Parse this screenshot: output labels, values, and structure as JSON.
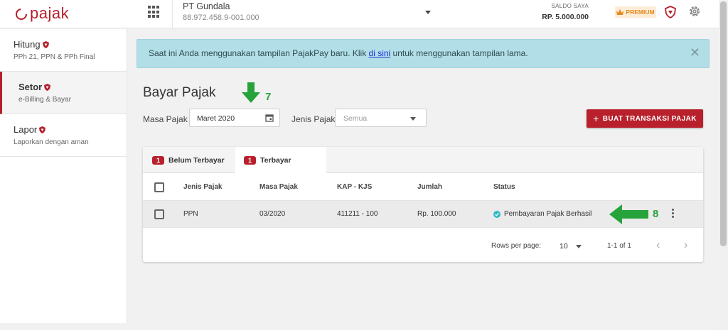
{
  "header": {
    "logo": "pajak",
    "company_name": "PT Gundala",
    "company_npwp": "88.972.458.9-001.000",
    "saldo_label": "SALDO SAYA",
    "saldo_value": "RP. 5.000.000",
    "premium_label": "PREMIUM",
    "brand_color": "#b5202b"
  },
  "sidebar": {
    "items": [
      {
        "title": "Hitung",
        "subtitle": "PPh 21, PPN & PPh Final",
        "active": false
      },
      {
        "title": "Setor",
        "subtitle": "e-Billing & Bayar",
        "active": true
      },
      {
        "title": "Lapor",
        "subtitle": "Laporkan dengan aman",
        "active": false
      }
    ]
  },
  "alert": {
    "text_before": "Saat ini Anda menggunakan tampilan PajakPay baru. Klik ",
    "link": "di sini",
    "text_after": " untuk menggunakan tampilan lama.",
    "close": "✕"
  },
  "page": {
    "title": "Bayar Pajak",
    "annotation_7": "7",
    "annotation_8": "8",
    "annotation_color": "#27a33c"
  },
  "filters": {
    "masa_label": "Masa Pajak",
    "masa_value": "Maret 2020",
    "jenis_label": "Jenis Pajak",
    "jenis_placeholder": "Semua"
  },
  "actions": {
    "buat_label": "BUAT TRANSAKSI PAJAK"
  },
  "tabs": [
    {
      "count": "1",
      "label": "Belum Terbayar"
    },
    {
      "count": "1",
      "label": "Terbayar"
    }
  ],
  "table": {
    "columns": [
      "Jenis Pajak",
      "Masa Pajak",
      "KAP - KJS",
      "Jumlah",
      "Status"
    ],
    "rows": [
      {
        "jenis": "PPN",
        "masa": "03/2020",
        "kap": "411211 - 100",
        "jumlah": "Rp. 100.000",
        "status": "Pembayaran Pajak Berhasil"
      }
    ]
  },
  "pagination": {
    "rows_per_page_label": "Rows per page:",
    "rows_per_page_value": "10",
    "range": "1-1 of 1"
  }
}
